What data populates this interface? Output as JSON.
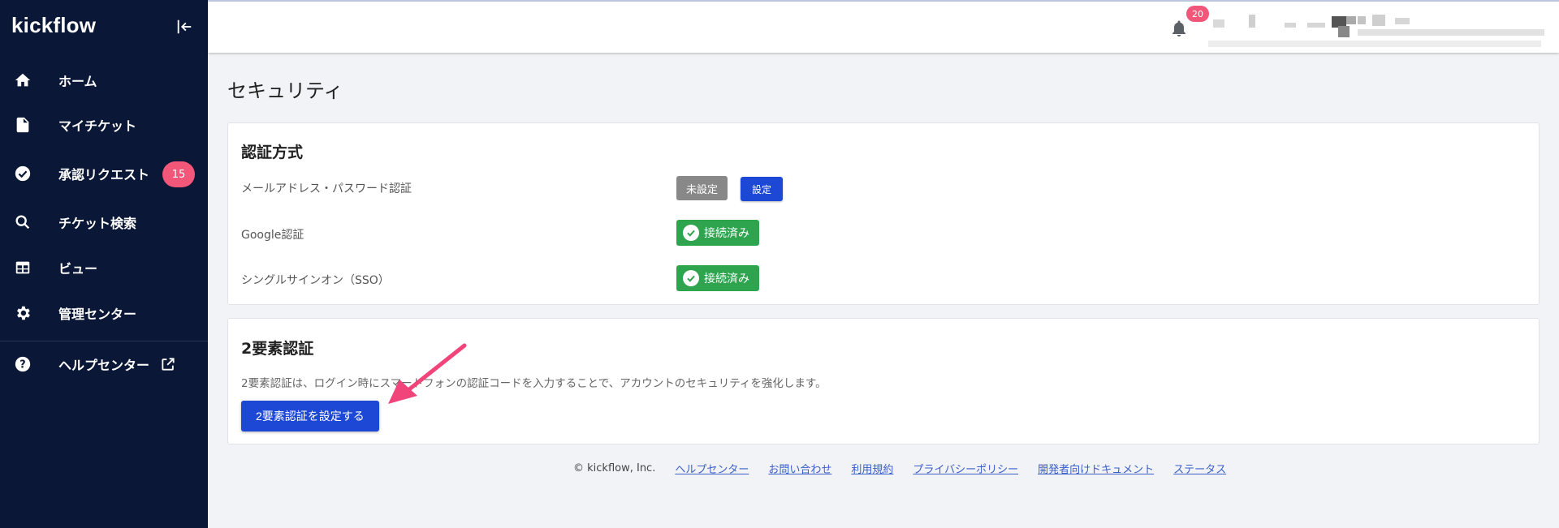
{
  "sidebar": {
    "brand": "kickflow",
    "items": [
      {
        "label": "ホーム",
        "icon": "home-icon"
      },
      {
        "label": "マイチケット",
        "icon": "document-icon"
      },
      {
        "label": "承認リクエスト",
        "icon": "check-circle-icon",
        "badge": "15"
      },
      {
        "label": "チケット検索",
        "icon": "search-icon"
      },
      {
        "label": "ビュー",
        "icon": "table-icon"
      },
      {
        "label": "管理センター",
        "icon": "gear-icon"
      },
      {
        "label": "ヘルプセンター",
        "icon": "help-icon",
        "external": true
      }
    ]
  },
  "header": {
    "notification_count": "20"
  },
  "main": {
    "title": "セキュリティ",
    "auth_card": {
      "title": "認証方式",
      "rows": [
        {
          "label": "メールアドレス・パスワード認証",
          "status": "未設定",
          "action": "設定"
        },
        {
          "label": "Google認証",
          "status": "接続済み"
        },
        {
          "label": "シングルサインオン（SSO）",
          "status": "接続済み"
        }
      ]
    },
    "two_factor_card": {
      "title": "2要素認証",
      "description": "2要素認証は、ログイン時にスマートフォンの認証コードを入力することで、アカウントのセキュリティを強化します。",
      "button": "2要素認証を設定する"
    }
  },
  "footer": {
    "copyright": "© kickflow, Inc.",
    "links": [
      "ヘルプセンター",
      "お問い合わせ",
      "利用規約",
      "プライバシーポリシー",
      "開発者向けドキュメント",
      "ステータス"
    ]
  },
  "colors": {
    "sidebar_bg": "#0b1736",
    "primary": "#1d48d6",
    "success": "#2ea44f",
    "badge": "#f2577a",
    "annotation_arrow": "#f0447a"
  }
}
